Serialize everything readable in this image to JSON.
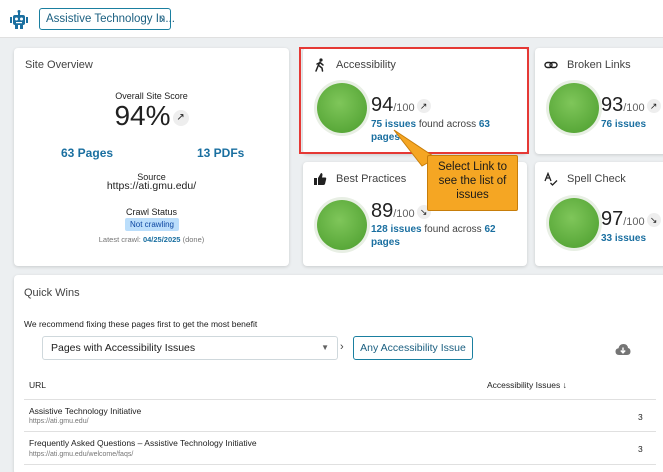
{
  "header": {
    "site_button_label": "Assistive Technology In...",
    "site_button_chevron": "›"
  },
  "overview": {
    "title": "Site Overview",
    "score_label": "Overall Site Score",
    "score_value": "94%",
    "pages_link": "63 Pages",
    "pdfs_link": "13 PDFs",
    "source_label": "Source",
    "source_value": "https://ati.gmu.edu/",
    "crawl_label": "Crawl Status",
    "crawl_status": "Not crawling",
    "latest_prefix": "Latest crawl:",
    "latest_date": "04/25/2025",
    "latest_suffix": "(done)"
  },
  "accessibility": {
    "title": "Accessibility",
    "score": "94",
    "of": "/100",
    "issues_link": "75 issues",
    "mid": "found across",
    "pages_link": "63 pages"
  },
  "broken_links": {
    "title": "Broken Links",
    "score": "93",
    "of": "/100",
    "issues_link": "76 issues"
  },
  "best_practices": {
    "title": "Best Practices",
    "score": "89",
    "of": "/100",
    "issues_link": "128 issues",
    "mid": "found across",
    "pages_link": "62",
    "pages_word": "pages"
  },
  "spell_check": {
    "title": "Spell Check",
    "score": "97",
    "of": "/100",
    "issues_link": "33 issues"
  },
  "callout": {
    "line1": "Select Link to",
    "line2": "see the list of",
    "line3": "issues"
  },
  "quick_wins": {
    "title": "Quick Wins",
    "description": "We recommend fixing these pages first to get the most benefit",
    "select_value": "Pages with Accessibility Issues",
    "filter_button": "Any Accessibility Issue",
    "col_url": "URL",
    "col_issues": "Accessibility Issues",
    "sort_icon": "↓",
    "rows": [
      {
        "title": "Assistive Technology Initiative",
        "url": "https://ati.gmu.edu/",
        "count": "3"
      },
      {
        "title": "Frequently Asked Questions – Assistive Technology Initiative",
        "url": "https://ati.gmu.edu/welcome/faqs/",
        "count": "3"
      }
    ]
  },
  "icons": {
    "logo": "robot-logo-icon",
    "accessibility": "person-walking-icon",
    "broken": "link-icon",
    "best": "thumbs-up-icon",
    "spell": "spellcheck-icon",
    "trend": "trending-icon",
    "download": "cloud-download-icon"
  },
  "colors": {
    "accent": "#1a6fa0",
    "gauge": "#5aa93a",
    "highlight": "#e53935",
    "callout": "#f5a623"
  }
}
